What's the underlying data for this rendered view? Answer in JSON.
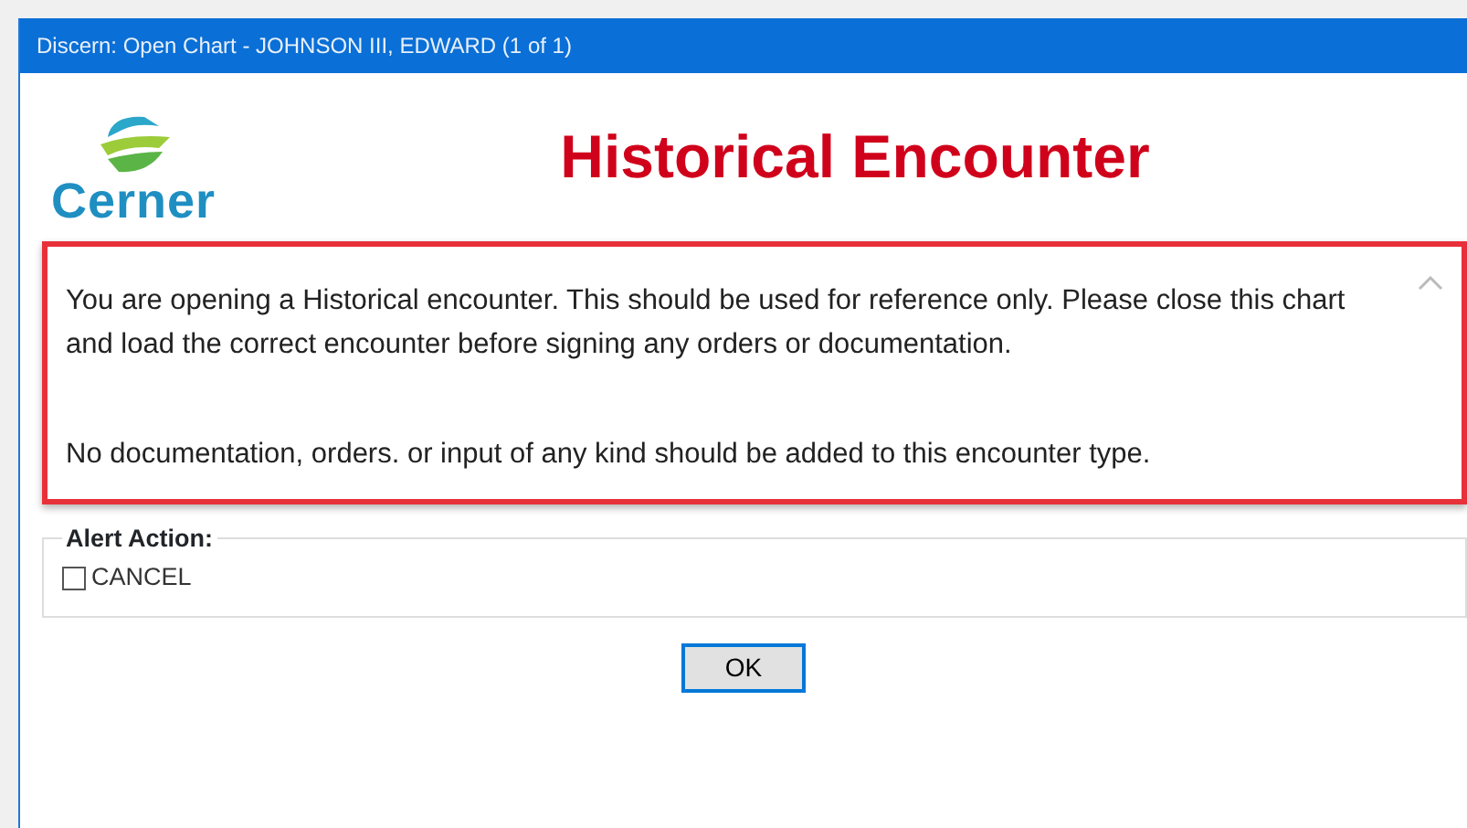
{
  "window": {
    "title": "Discern: Open Chart - JOHNSON III, EDWARD (1 of 1)"
  },
  "logo": {
    "text": "Cerner"
  },
  "heading": "Historical Encounter",
  "message": {
    "paragraphs": [
      "You are opening a Historical encounter. This should be used for reference only. Please close this chart and load the correct encounter before signing any orders or documentation.",
      "No documentation, orders. or input of any kind should be added to this encounter type."
    ],
    "highlighted": true
  },
  "alert_action": {
    "label": "Alert Action:",
    "options": [
      {
        "label": "CANCEL",
        "checked": false
      }
    ]
  },
  "buttons": [
    {
      "label": "OK",
      "focused": true
    }
  ]
}
